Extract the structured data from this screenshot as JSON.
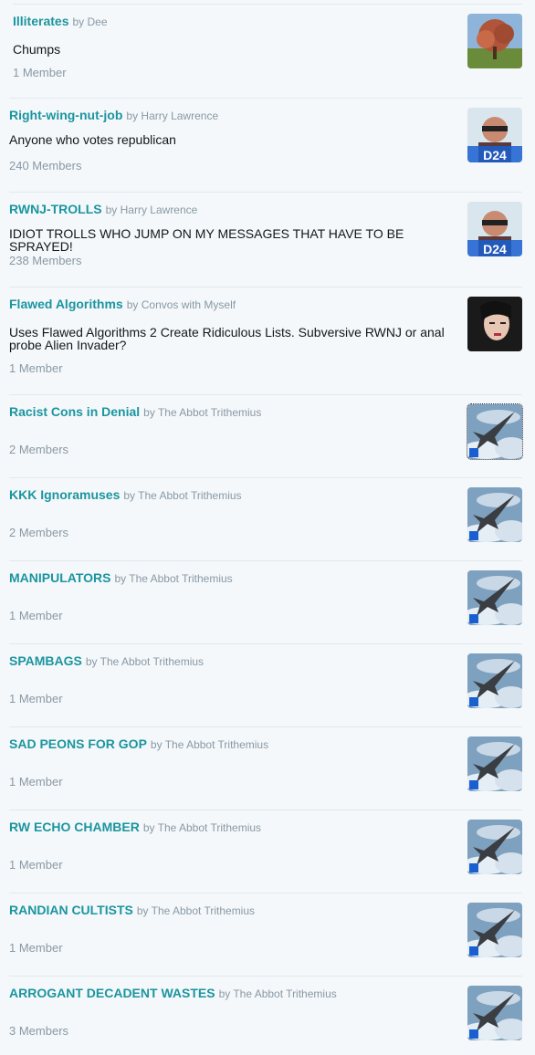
{
  "lists": [
    {
      "title": "Illiterates",
      "by": "by Dee",
      "description": "Chumps",
      "members": "1 Member"
    },
    {
      "title": "Right-wing-nut-job",
      "by": "by Harry Lawrence",
      "description": "Anyone who votes republican",
      "members": "240 Members"
    },
    {
      "title": "RWNJ-TROLLS",
      "by": "by Harry Lawrence",
      "description": "IDIOT TROLLS WHO JUMP ON MY MESSAGES THAT HAVE TO BE SPRAYED!",
      "members": "238 Members"
    },
    {
      "title": "Flawed Algorithms",
      "by": "by Convos with Myself",
      "description": "Uses Flawed Algorithms 2 Create Ridiculous Lists. Subversive RWNJ or anal probe Alien Invader?",
      "members": "1 Member"
    },
    {
      "title": "Racist Cons in Denial",
      "by": "by The Abbot Trithemius",
      "description": "",
      "members": "2 Members"
    },
    {
      "title": "KKK Ignoramuses",
      "by": "by The Abbot Trithemius",
      "description": "",
      "members": "2 Members"
    },
    {
      "title": "MANIPULATORS",
      "by": "by The Abbot Trithemius",
      "description": "",
      "members": "1 Member"
    },
    {
      "title": "SPAMBAGS",
      "by": "by The Abbot Trithemius",
      "description": "",
      "members": "1 Member"
    },
    {
      "title": "SAD PEONS FOR GOP",
      "by": "by The Abbot Trithemius",
      "description": "",
      "members": "1 Member"
    },
    {
      "title": "RW ECHO CHAMBER",
      "by": "by The Abbot Trithemius",
      "description": "",
      "members": "1 Member"
    },
    {
      "title": "RANDIAN CULTISTS",
      "by": "by The Abbot Trithemius",
      "description": "",
      "members": "1 Member"
    },
    {
      "title": "ARROGANT DECADENT WASTES",
      "by": "by The Abbot Trithemius",
      "description": "",
      "members": "3 Members"
    }
  ],
  "avatars": {
    "0": "tree-photo-icon",
    "1": "man-glasses-photo-icon",
    "2": "man-glasses-photo-icon",
    "3": "woman-portrait-photo-icon",
    "4": "jet-fighter-photo-icon"
  },
  "colors": {
    "link": "#1b95a0",
    "muted": "#8899a6",
    "text": "#14171a",
    "background": "#f5f8fa",
    "divider": "#e1e8ed"
  }
}
